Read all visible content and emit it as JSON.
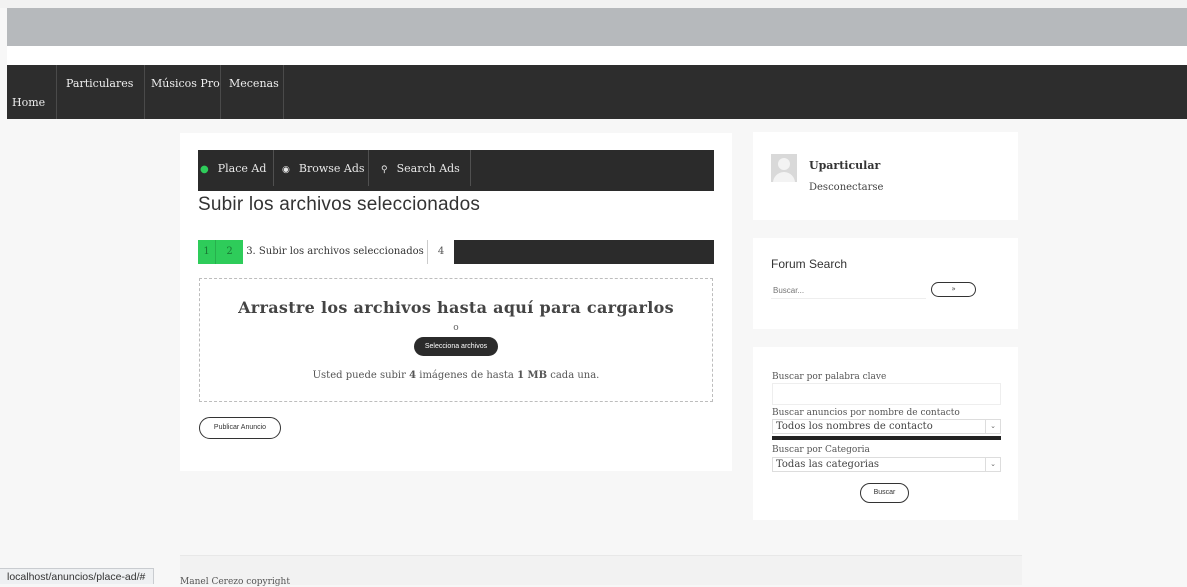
{
  "nav": {
    "items": [
      {
        "label": "Home"
      },
      {
        "label": "Particulares"
      },
      {
        "label": "Músicos Pro"
      },
      {
        "label": "Mecenas"
      }
    ]
  },
  "ad_tabs": {
    "items": [
      {
        "label": "Place Ad",
        "icon": "circle-icon"
      },
      {
        "label": "Browse Ads",
        "icon": "eye-icon"
      },
      {
        "label": "Search Ads",
        "icon": "search-icon"
      }
    ]
  },
  "main": {
    "title": "Subir los archivos seleccionados",
    "steps": [
      "1",
      "2",
      "3. Subir los archivos seleccionados",
      "4"
    ],
    "dropzone": {
      "title": "Arrastre los archivos hasta aquí para cargarlos",
      "or": "o",
      "select_button": "Selecciona archivos",
      "note_prefix": "Usted puede subir ",
      "note_count": "4",
      "note_mid": " imágenes de hasta ",
      "note_size": "1 MB",
      "note_suffix": " cada una."
    },
    "publish_button": "Publicar Anuncio"
  },
  "user_card": {
    "username": "Uparticular",
    "logout": "Desconectarse"
  },
  "forum_search": {
    "title": "Forum Search",
    "placeholder": "Buscar...",
    "button": "»"
  },
  "filters": {
    "keyword_label": "Buscar por palabra clave",
    "contact_label": "Buscar anuncios por nombre de contacto",
    "contact_value": "Todos los nombres de contacto",
    "category_label": "Buscar por Categoria",
    "category_value": "Todas las categorias",
    "button": "Buscar"
  },
  "footer": {
    "text": "Manel Cerezo copyright"
  },
  "statusbar": {
    "url": "localhost/anuncios/place-ad/#"
  },
  "colors": {
    "nav_bg": "#2d2d2d",
    "step_active": "#2ecc5a",
    "banner": "#b6b9bc"
  }
}
